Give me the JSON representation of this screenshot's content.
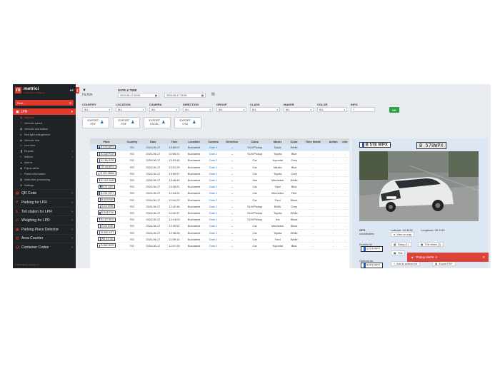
{
  "brand": {
    "logo_letter": "m",
    "name": "metrici",
    "tagline": "smart vision intelligence"
  },
  "sidebar": {
    "find_placeholder": "Find ...",
    "section": "LPR",
    "sub_items": [
      {
        "label": "Vehicles",
        "icon": "car-icon",
        "active": true
      },
      {
        "label": "Vehicles speed",
        "icon": "speed-icon"
      },
      {
        "label": "Vehicles and trailers",
        "icon": "truck-icon"
      },
      {
        "label": "Red light infringement",
        "icon": "traffic-light-icon"
      },
      {
        "label": "Vehicles flow",
        "icon": "flow-icon"
      },
      {
        "label": "Live view",
        "icon": "monitor-icon"
      },
      {
        "label": "Reports",
        "icon": "chart-icon",
        "has_children": true
      },
      {
        "label": "Actions",
        "icon": "bolt-icon",
        "has_children": true
      },
      {
        "label": "Alarms",
        "icon": "bell-icon"
      },
      {
        "label": "Popup alerts",
        "icon": "alert-icon"
      },
      {
        "label": "Plates information",
        "icon": "list-icon"
      },
      {
        "label": "Video files processing",
        "icon": "film-icon"
      },
      {
        "label": "Settings",
        "icon": "gear-icon"
      }
    ],
    "nav_items": [
      {
        "label": "QR Code",
        "icon": "qr-icon"
      },
      {
        "label": "Parking for LPR",
        "icon": "parking-icon"
      },
      {
        "label": "Toll station for LPR",
        "icon": "dollar-icon"
      },
      {
        "label": "Weighing for LPR",
        "icon": "scale-icon"
      },
      {
        "label": "Parking Place Detector",
        "icon": "car-icon"
      },
      {
        "label": "Area Counter",
        "icon": "counter-icon"
      },
      {
        "label": "Container Codes",
        "icon": "container-icon"
      }
    ],
    "footer": "© 2024 Metrici. Version 2.0"
  },
  "filters": {
    "filter_label": "FILTER",
    "date_time_label": "DATE & TIME",
    "date_from": "2024-06-17 00:00",
    "date_to": "2024-06-17 23:59",
    "fields": [
      {
        "label": "COUNTRY",
        "value": "ALL"
      },
      {
        "label": "LOCATION",
        "value": "ALL"
      },
      {
        "label": "CAMERA",
        "value": "ALL"
      },
      {
        "label": "DIRECTION",
        "value": "ALL"
      },
      {
        "label": "GROUP",
        "value": "ALL"
      },
      {
        "label": "CLASS",
        "value": "ALL"
      },
      {
        "label": "MAKER",
        "value": "ALL"
      },
      {
        "label": "COLOR",
        "value": "ALL"
      },
      {
        "label": "INFO",
        "value": "?"
      }
    ],
    "ok_label": "OK",
    "exports": [
      {
        "line1": "EXPORT",
        "line2": "PDF"
      },
      {
        "line1": "EXPORT",
        "line2": "PDF"
      },
      {
        "line1": "EXPORT",
        "line2": "EXCEL"
      },
      {
        "line1": "EXPORT",
        "line2": "CSV"
      }
    ]
  },
  "table": {
    "columns": [
      "Plate",
      "Country",
      "Date",
      "Time",
      "Location",
      "Camera",
      "Direction",
      "Class",
      "Maker",
      "Color",
      "Time inside",
      "Action",
      "Info"
    ],
    "rows": [
      [
        "B 578 WPX",
        "RO",
        "2024-06-17",
        "13:50:07",
        "Bucharest",
        "Gate 2",
        "→",
        "SUV/Pickup",
        "Dacia",
        "White",
        "-",
        "-",
        "-"
      ],
      [
        "B 126 POH",
        "RO",
        "2024-06-17",
        "13:55:21",
        "Bucharest",
        "Gate 2",
        "→",
        "SUV/Pickup",
        "Toyota",
        "Blue",
        "-",
        "-",
        "-"
      ],
      [
        "B 186 KGB",
        "RO",
        "2024-06-17",
        "13:51:45",
        "Bucharest",
        "Gate 2",
        "→",
        "Car",
        "Hyundai",
        "Grey",
        "-",
        "-",
        "-"
      ],
      [
        "TR 44 MTG",
        "RO",
        "2024-06-17",
        "13:51:29",
        "Bucharest",
        "Gate 2",
        "→",
        "Car",
        "Mazda",
        "Blue",
        "-",
        "-",
        "-"
      ],
      [
        "B 221 MMM",
        "RO",
        "2024-06-17",
        "13:50:57",
        "Bucharest",
        "Gate 2",
        "→",
        "Car",
        "Toyota",
        "Grey",
        "-",
        "-",
        "-"
      ],
      [
        "B 454 HUB",
        "RO",
        "2024-06-17",
        "13:48:49",
        "Bucharest",
        "Gate 2",
        "→",
        "Van",
        "Mercedes",
        "White",
        "-",
        "-",
        "-"
      ],
      [
        "B 70 UZZ",
        "RO",
        "2024-06-17",
        "13:45:21",
        "Bucharest",
        "Gate 2",
        "→",
        "Car",
        "Opel",
        "Blue",
        "-",
        "-",
        "-"
      ],
      [
        "B 231 WTY",
        "RO",
        "2024-06-17",
        "12:44:24",
        "Bucharest",
        "Gate 2",
        "→",
        "Car",
        "Mercedes",
        "Red",
        "-",
        "-",
        "-"
      ],
      [
        "B 678 KIR",
        "RO",
        "2024-06-17",
        "12:44:22",
        "Bucharest",
        "Gate 2",
        "→",
        "Car",
        "Ford",
        "Black",
        "-",
        "-",
        "-"
      ],
      [
        "B 15 SRB",
        "RO",
        "2024-06-17",
        "12:42:46",
        "Bucharest",
        "Gate 2",
        "→",
        "SUV/Pickup",
        "BMW",
        "Grey",
        "-",
        "-",
        "-"
      ],
      [
        "B 543 EVA",
        "RO",
        "2024-06-17",
        "12:42:37",
        "Bucharest",
        "Gate 2",
        "→",
        "SUV/Pickup",
        "Toyota",
        "White",
        "-",
        "-",
        "-"
      ],
      [
        "B 127 SKO",
        "RO",
        "2024-06-17",
        "12:41:03",
        "Bucharest",
        "Gate 2",
        "→",
        "SUV/Pickup",
        "Kia",
        "Black",
        "-",
        "-",
        "-"
      ],
      [
        "B 43 KXE",
        "RO",
        "2024-06-17",
        "12:39:52",
        "Bucharest",
        "Gate 2",
        "→",
        "Car",
        "Mercedes",
        "Black",
        "-",
        "-",
        "-"
      ],
      [
        "B 300 KPT",
        "RO",
        "2024-06-17",
        "12:38:28",
        "Bucharest",
        "Gate 2",
        "→",
        "Car",
        "Toyota",
        "White",
        "-",
        "-",
        "-"
      ],
      [
        "AB 43 JID",
        "RO",
        "2024-06-17",
        "12:39:14",
        "Bucharest",
        "Gate 2",
        "→",
        "Car",
        "Ford",
        "White",
        "-",
        "-",
        "-"
      ],
      [
        "B 860 NDR",
        "RO",
        "2024-06-17",
        "12:37:28",
        "Bucharest",
        "Gate 2",
        "→",
        "Car",
        "Hyundai",
        "Blue",
        "-",
        "-",
        "-"
      ]
    ]
  },
  "detail": {
    "plate": "B 578 WPX",
    "plate_image_text": "B 578WPX",
    "gps_label": "GPS",
    "coordinates_label": "coordinates",
    "latitude": "Latitude: 44.4452",
    "longitude": "Longitude: 26.1115",
    "view_on_map": "View on map",
    "events_label": "Events for",
    "events_plate": "B 578 WPX",
    "today": "Today (1)",
    "this_week": "This Week (1)",
    "this_month": "This",
    "options_label": "Options for",
    "options_plate": "B 578 WPX",
    "add_to_actions": "Add to actions list",
    "export_pdf": "Export PDF"
  },
  "toast": {
    "text": "Popup alerts: 4",
    "color": "#d9433a"
  },
  "colors": {
    "accent": "#e03a2f",
    "sidebar": "#1f2326",
    "link": "#1e6fc2",
    "ok": "#2f9e44"
  }
}
